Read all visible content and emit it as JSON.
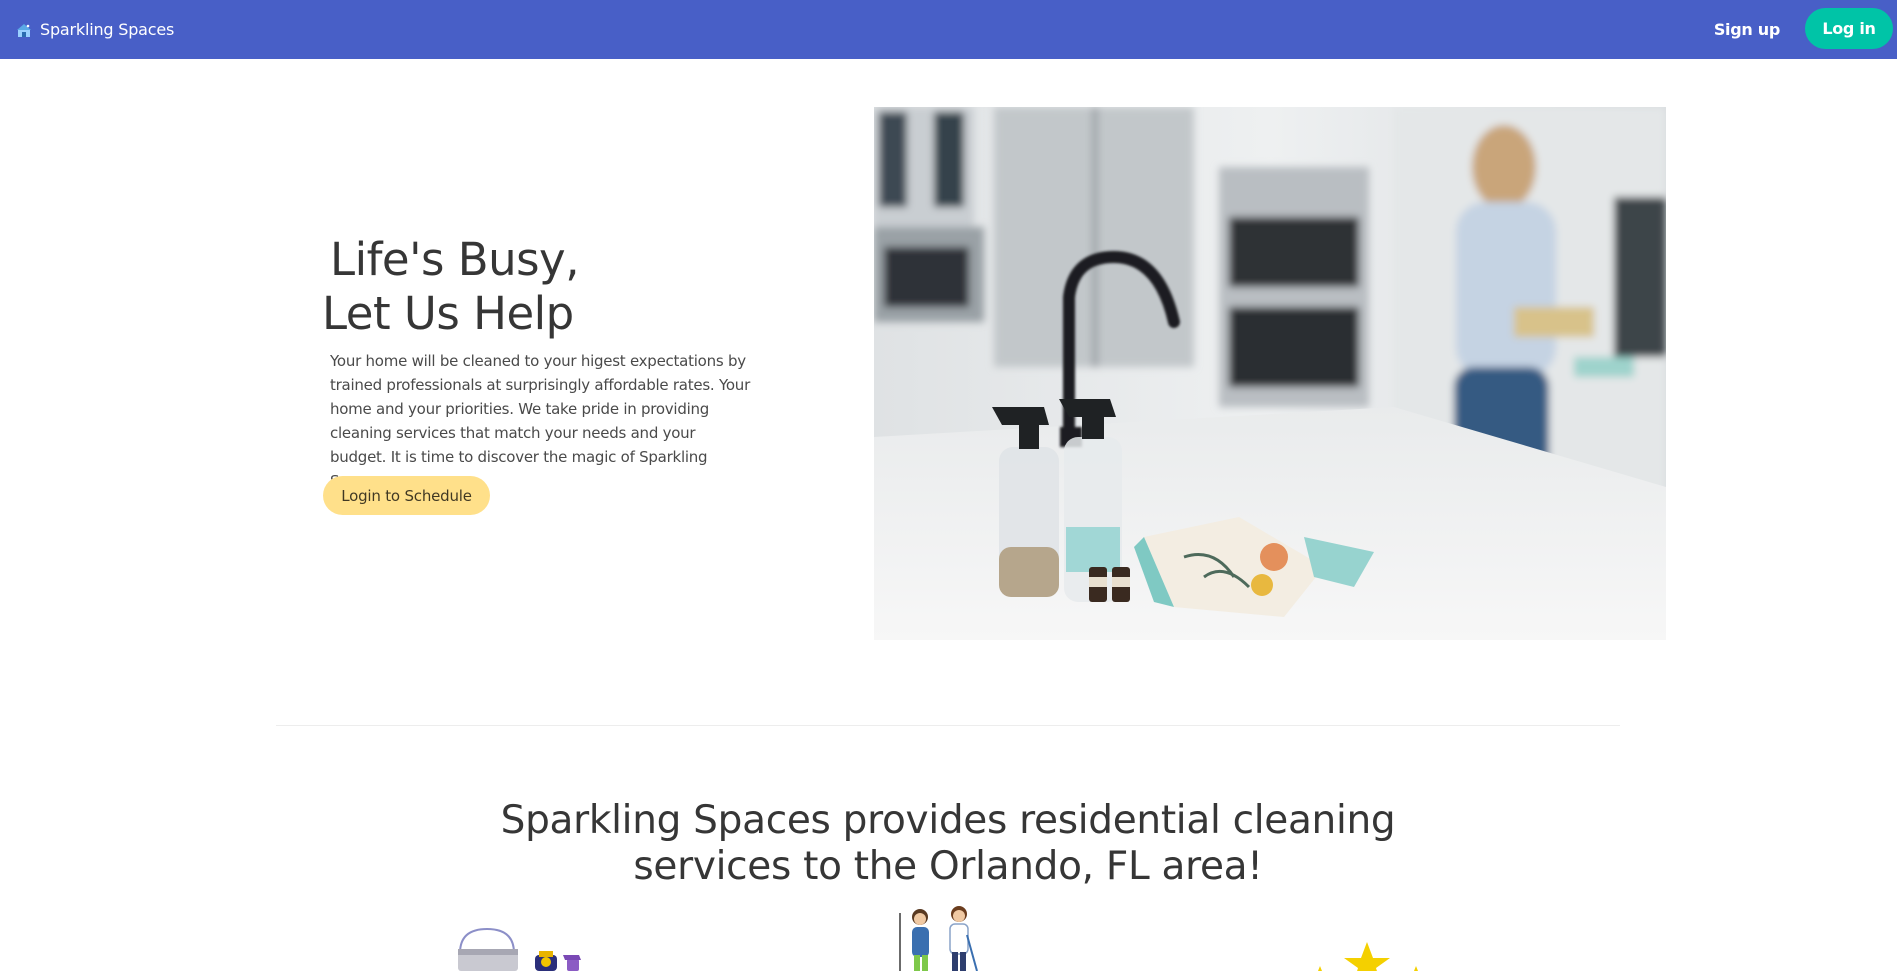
{
  "navbar": {
    "brand": "Sparkling Spaces",
    "brand_icon": "house-logo-icon",
    "signup_label": "Sign up",
    "login_label": "Log in",
    "color": "#485fc7",
    "login_color": "#00c4a7"
  },
  "hero": {
    "title_line1": "Life's Busy,",
    "title_line2": "Let Us Help",
    "body": "Your home will be cleaned to your higest expectations by trained professionals at surprisingly affordable rates. Your home and your priorities. We take pride in providing cleaning services that match your needs and your budget. It is time to discover the magic of Sparkling Spaces.",
    "cta_label": "Login to Schedule",
    "cta_color": "#ffe08a",
    "photo": "kitchen-cleaning-photo"
  },
  "services": {
    "title": "Sparkling Spaces provides residential cleaning services to the Orlando, FL area!",
    "illustrations": [
      "cleaning-supplies-icon",
      "cleaning-team-icon",
      "rating-stars-icon"
    ]
  }
}
